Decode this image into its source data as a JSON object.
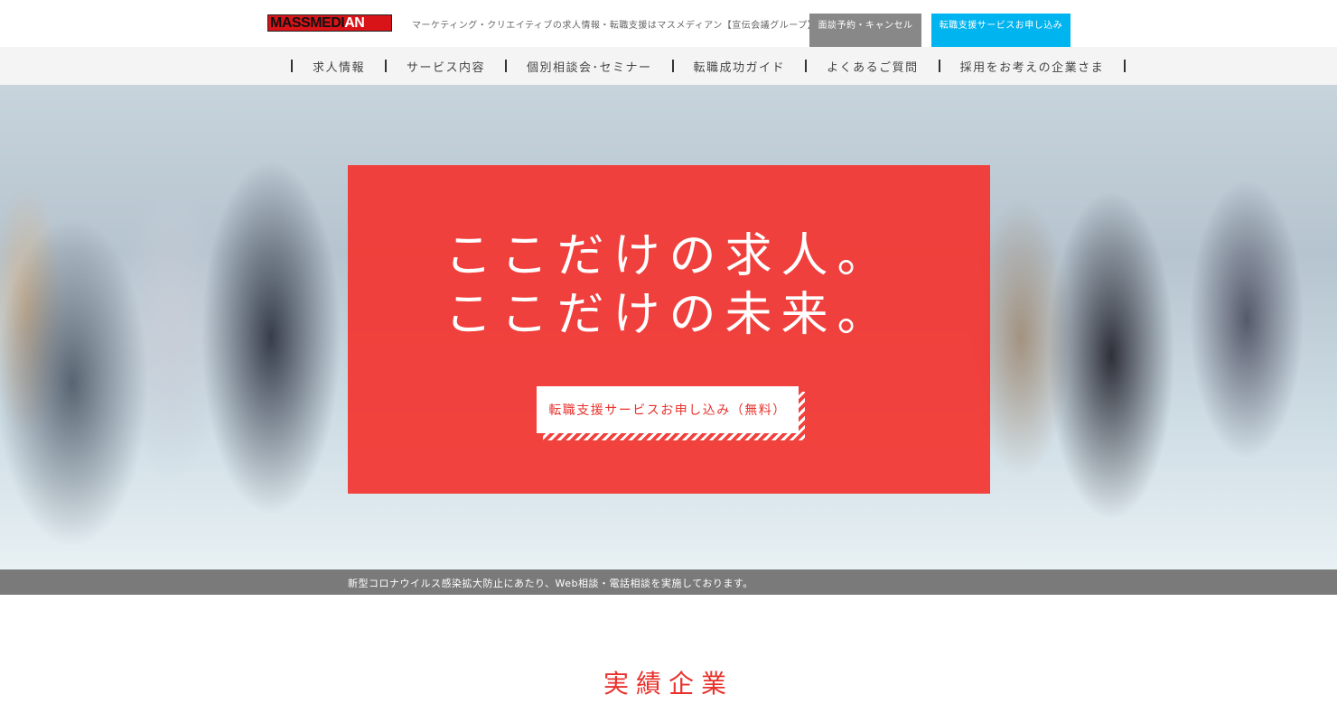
{
  "header": {
    "logo_main": "MASSMEDI",
    "logo_accent": "AN",
    "tagline": "マーケティング・クリエイティブの求人情報・転職支援はマスメディアン【宣伝会議グループ】",
    "reserve_button": "面談予約・キャンセル",
    "apply_button": "転職支援サービスお申し込み"
  },
  "nav": {
    "items": [
      {
        "label": "求人情報"
      },
      {
        "label": "サービス内容"
      },
      {
        "label": "個別相談会･セミナー"
      },
      {
        "label": "転職成功ガイド"
      },
      {
        "label": "よくあるご質問"
      },
      {
        "label": "採用をお考えの企業さま"
      }
    ]
  },
  "hero": {
    "line1": "ここだけの求人。",
    "line2": "ここだけの未来。",
    "cta": "転職支援サービスお申し込み（無料）"
  },
  "notice": {
    "text": "新型コロナウイルス感染拡大防止にあたり、Web相談・電話相談を実施しております。"
  },
  "section": {
    "title": "実績企業"
  },
  "colors": {
    "brand_red": "#e8322c",
    "apply_blue": "#00b4f0",
    "reserve_gray": "#888888"
  }
}
